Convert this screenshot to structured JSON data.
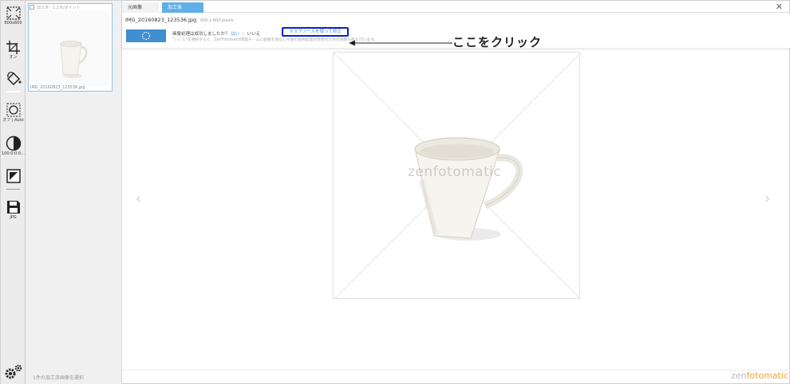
{
  "toolbar": {
    "tools": [
      {
        "name": "resize",
        "label": "600x600"
      },
      {
        "name": "crop",
        "label": "オン"
      },
      {
        "name": "bucket",
        "label": ""
      },
      {
        "name": "lasso",
        "label": "オフ | Auto"
      },
      {
        "name": "contrast",
        "label": "100:0:0:0..."
      },
      {
        "name": "image-adjust",
        "label": ""
      },
      {
        "name": "save",
        "label": "JPG"
      }
    ]
  },
  "thumbnail": {
    "header": "加工済　1.2点/ポイント",
    "filename": "IMG_20160823_123536.jpg"
  },
  "tabs": {
    "original": "元画像",
    "processed": "加工後"
  },
  "info": {
    "filename": "IMG_20160823_123536.jpg",
    "dimensions": "600 x 600 pixels",
    "question": "画像処理は成功しましたか？",
    "yes": "はい",
    "separator": "|",
    "no": "いいえ",
    "mask_link": "マスクツールを使って修正",
    "note": "\"いいえ\"を選択すると、ZenFotomatic開発チームに画像を送信し今後の画像処理の改善のための画像分析を行います。"
  },
  "callout": {
    "text": "ここをクリック"
  },
  "canvas": {
    "watermark": "zenfotomatic"
  },
  "status": {
    "text": "1件の加工済画像を選択"
  },
  "brand": {
    "prefix": "zen",
    "accent": "fotomatic"
  },
  "colors": {
    "accent_blue": "#5fb0e6",
    "callout_border": "#0a1fd0",
    "link_blue": "#3a8fd8",
    "brand_orange": "#f2a23a"
  }
}
